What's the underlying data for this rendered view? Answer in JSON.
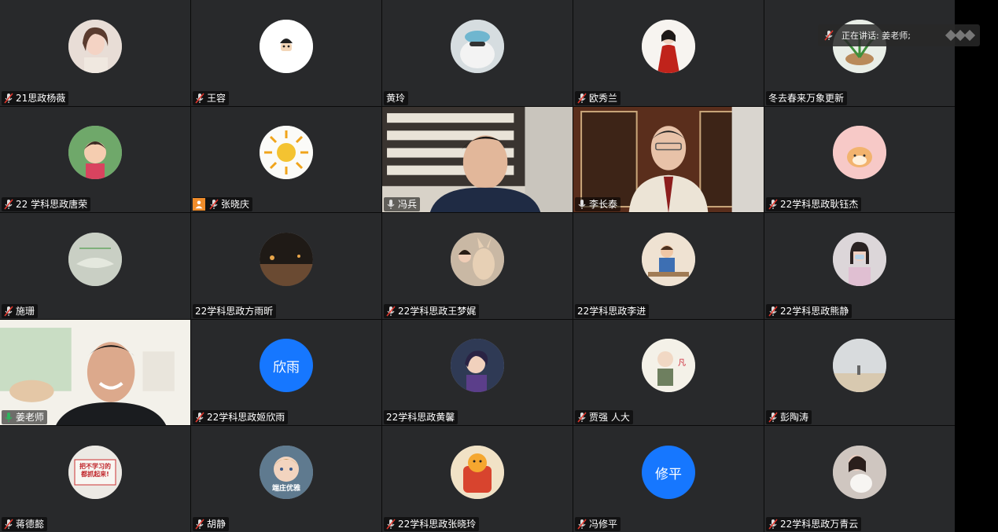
{
  "speaking_indicator": {
    "label": "正在讲话: 姜老师;"
  },
  "participants": [
    {
      "name": "21思政杨薇",
      "avatar": "photo-woman-portrait",
      "mic": "muted"
    },
    {
      "name": "王容",
      "avatar": "cartoon-face",
      "mic": "muted"
    },
    {
      "name": "黄玲",
      "avatar": "photo-cat-with-hat",
      "mic": "none"
    },
    {
      "name": "欧秀兰",
      "avatar": "photo-woman-red-dress",
      "mic": "muted"
    },
    {
      "name": "冬去春来万象更新",
      "avatar": "photo-plant",
      "mic": "none"
    },
    {
      "name": "22 学科思政唐荣",
      "avatar": "cartoon-girl",
      "mic": "muted"
    },
    {
      "name": "张晓庆",
      "avatar": "drawn-sun",
      "mic": "muted",
      "badge": "host-person-icon"
    },
    {
      "name": "冯兵",
      "video": "man-with-bookshelf",
      "mic": "active"
    },
    {
      "name": "李长泰",
      "video": "man-with-wooden-cabinet",
      "mic": "active"
    },
    {
      "name": "22学科思政耿钰杰",
      "avatar": "cartoon-hamster",
      "mic": "muted"
    },
    {
      "name": "施珊",
      "avatar": "photo-sketch",
      "mic": "muted"
    },
    {
      "name": "22学科思政方雨昕",
      "avatar": "photo-night-street",
      "mic": "none"
    },
    {
      "name": "22学科思政王梦娓",
      "avatar": "photo-dog-with-girl",
      "mic": "muted"
    },
    {
      "name": "22学科思政李进",
      "avatar": "photo-child",
      "mic": "none"
    },
    {
      "name": "22学科思政熊静",
      "avatar": "photo-woman-masked",
      "mic": "muted"
    },
    {
      "name": "姜老师",
      "video": "man-smiling-room",
      "mic": "speaking",
      "speaking": true
    },
    {
      "name": "22学科思政姬欣雨",
      "avatar_text": "欣雨",
      "mic": "muted"
    },
    {
      "name": "22学科思政黄馨",
      "avatar": "cartoon-purple",
      "mic": "none"
    },
    {
      "name": "贾强 人大",
      "avatar": "cartoon-old-man",
      "mic": "muted"
    },
    {
      "name": "彭陶涛",
      "avatar": "photo-beach",
      "mic": "muted"
    },
    {
      "name": "蒋德懿",
      "avatar": "sign-text",
      "avatar_caption": "把不学习的\n都抓起来!",
      "mic": "muted"
    },
    {
      "name": "胡静",
      "avatar": "photo-baby",
      "avatar_caption": "端庄优雅",
      "mic": "muted"
    },
    {
      "name": "22学科思政张晓玲",
      "avatar": "cartoon-tiger",
      "mic": "muted"
    },
    {
      "name": "冯修平",
      "avatar_text": "修平",
      "mic": "muted"
    },
    {
      "name": "22学科思政万青云",
      "avatar": "photo-woman-dog",
      "mic": "muted"
    }
  ],
  "colors": {
    "tile_bg": "#28292b",
    "text_avatar_bg": "#1677ff",
    "active_speaker_border": "#2db55d",
    "muted_icon_red": "#e0362c",
    "host_badge": "#f08c2a"
  }
}
